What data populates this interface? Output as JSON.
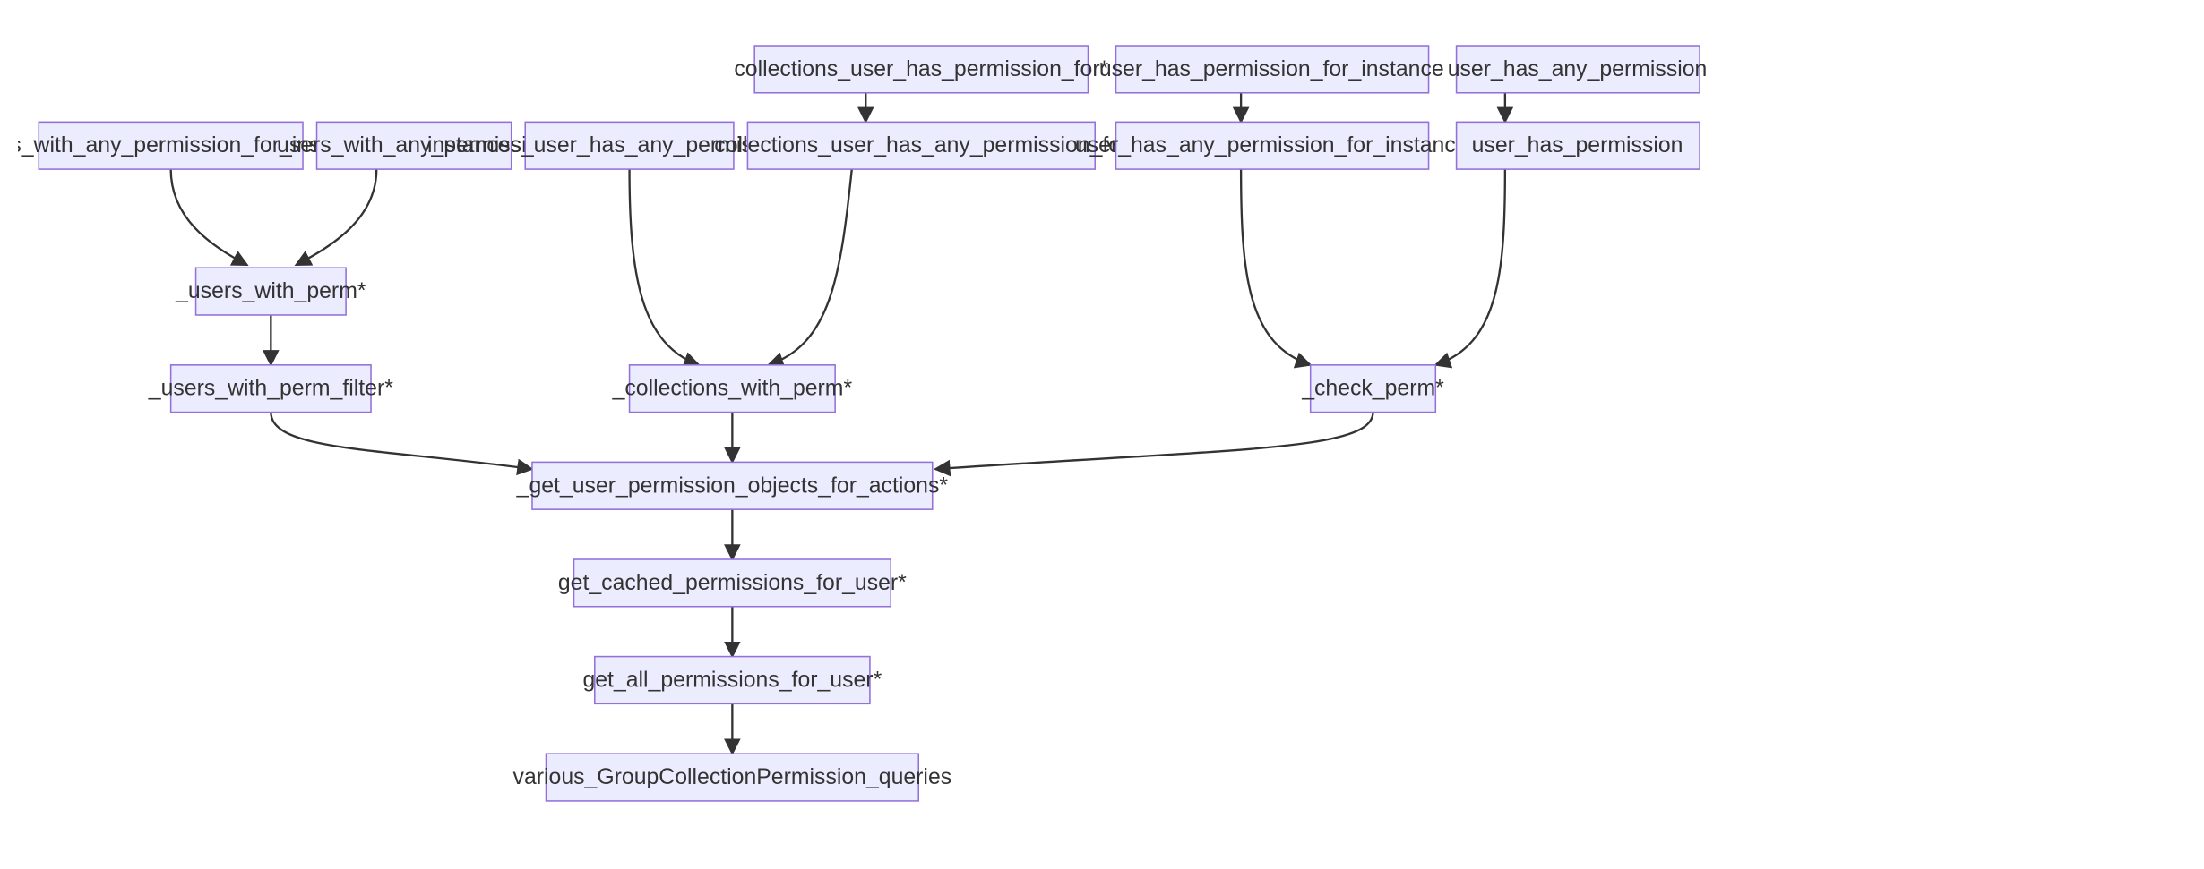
{
  "diagram": {
    "nodes": {
      "n_uwapfi": "users_with_any_permission_for_instance",
      "n_uwap": "users_with_any_permission",
      "n_iuhapf": "instances_user_has_any_permission_for",
      "n_cuhpf": "collections_user_has_permission_for*",
      "n_cuhapf": "collections_user_has_any_permission_for",
      "n_uhpfi": "user_has_permission_for_instance",
      "n_uhapfi": "user_has_any_permission_for_instance",
      "n_uhap": "user_has_any_permission",
      "n_uhp": "user_has_permission",
      "n_uwp": "_users_with_perm*",
      "n_uwpf": "_users_with_perm_filter*",
      "n_cwp": "_collections_with_perm*",
      "n_cp": "_check_perm*",
      "n_gupofa": "_get_user_permission_objects_for_actions*",
      "n_gcpfu": "get_cached_permissions_for_user*",
      "n_gapfu": "get_all_permissions_for_user*",
      "n_vgcpq": "various_GroupCollectionPermission_queries"
    }
  },
  "chart_data": {
    "type": "flowchart",
    "direction": "top-down",
    "nodes": [
      "users_with_any_permission_for_instance",
      "users_with_any_permission",
      "instances_user_has_any_permission_for",
      "collections_user_has_permission_for*",
      "collections_user_has_any_permission_for",
      "user_has_permission_for_instance",
      "user_has_any_permission_for_instance",
      "user_has_any_permission",
      "user_has_permission",
      "_users_with_perm*",
      "_users_with_perm_filter*",
      "_collections_with_perm*",
      "_check_perm*",
      "_get_user_permission_objects_for_actions*",
      "get_cached_permissions_for_user*",
      "get_all_permissions_for_user*",
      "various_GroupCollectionPermission_queries"
    ],
    "edges": [
      [
        "users_with_any_permission_for_instance",
        "_users_with_perm*"
      ],
      [
        "users_with_any_permission",
        "_users_with_perm*"
      ],
      [
        "collections_user_has_permission_for*",
        "collections_user_has_any_permission_for"
      ],
      [
        "user_has_permission_for_instance",
        "user_has_any_permission_for_instance"
      ],
      [
        "user_has_any_permission",
        "user_has_permission"
      ],
      [
        "_users_with_perm*",
        "_users_with_perm_filter*"
      ],
      [
        "instances_user_has_any_permission_for",
        "_collections_with_perm*"
      ],
      [
        "collections_user_has_any_permission_for",
        "_collections_with_perm*"
      ],
      [
        "user_has_any_permission_for_instance",
        "_check_perm*"
      ],
      [
        "user_has_permission",
        "_check_perm*"
      ],
      [
        "_users_with_perm_filter*",
        "_get_user_permission_objects_for_actions*"
      ],
      [
        "_collections_with_perm*",
        "_get_user_permission_objects_for_actions*"
      ],
      [
        "_check_perm*",
        "_get_user_permission_objects_for_actions*"
      ],
      [
        "_get_user_permission_objects_for_actions*",
        "get_cached_permissions_for_user*"
      ],
      [
        "get_cached_permissions_for_user*",
        "get_all_permissions_for_user*"
      ],
      [
        "get_all_permissions_for_user*",
        "various_GroupCollectionPermission_queries"
      ]
    ]
  }
}
